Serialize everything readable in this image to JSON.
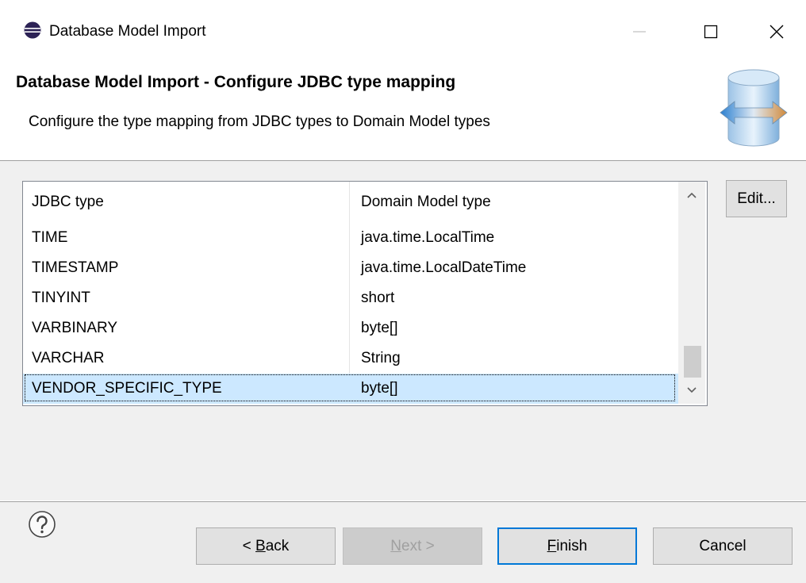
{
  "window": {
    "title": "Database Model Import",
    "app_icon": "eclipse-icon",
    "controls": {
      "minimize": "minimize-icon",
      "maximize": "maximize-icon",
      "close": "close-icon"
    }
  },
  "banner": {
    "title": "Database Model Import - Configure JDBC type mapping",
    "description": "Configure the type mapping from JDBC types to Domain Model types",
    "image": "database-transfer-icon"
  },
  "table": {
    "columns": [
      "JDBC type",
      "Domain Model type"
    ],
    "rows": [
      {
        "jdbc": "TIME",
        "domain": "java.time.LocalTime",
        "selected": false
      },
      {
        "jdbc": "TIMESTAMP",
        "domain": "java.time.LocalDateTime",
        "selected": false
      },
      {
        "jdbc": "TINYINT",
        "domain": "short",
        "selected": false
      },
      {
        "jdbc": "VARBINARY",
        "domain": "byte[]",
        "selected": false
      },
      {
        "jdbc": "VARCHAR",
        "domain": "String",
        "selected": false
      },
      {
        "jdbc": "VENDOR_SPECIFIC_TYPE",
        "domain": "byte[]",
        "selected": true
      }
    ],
    "scrollbar": {
      "up_icon": "chevron-up-icon",
      "down_icon": "chevron-down-icon"
    }
  },
  "side_buttons": {
    "edit": "Edit..."
  },
  "footer": {
    "help_icon": "help-icon",
    "back": {
      "prefix": "< ",
      "mnemonic": "B",
      "rest": "ack"
    },
    "next": {
      "mnemonic": "N",
      "rest": "ext >"
    },
    "finish": {
      "mnemonic": "F",
      "rest": "inish"
    },
    "cancel": "Cancel"
  },
  "colors": {
    "selection": "#cce8ff",
    "focus_border": "#0078d7",
    "dialog_bg": "#f0f0f0"
  }
}
